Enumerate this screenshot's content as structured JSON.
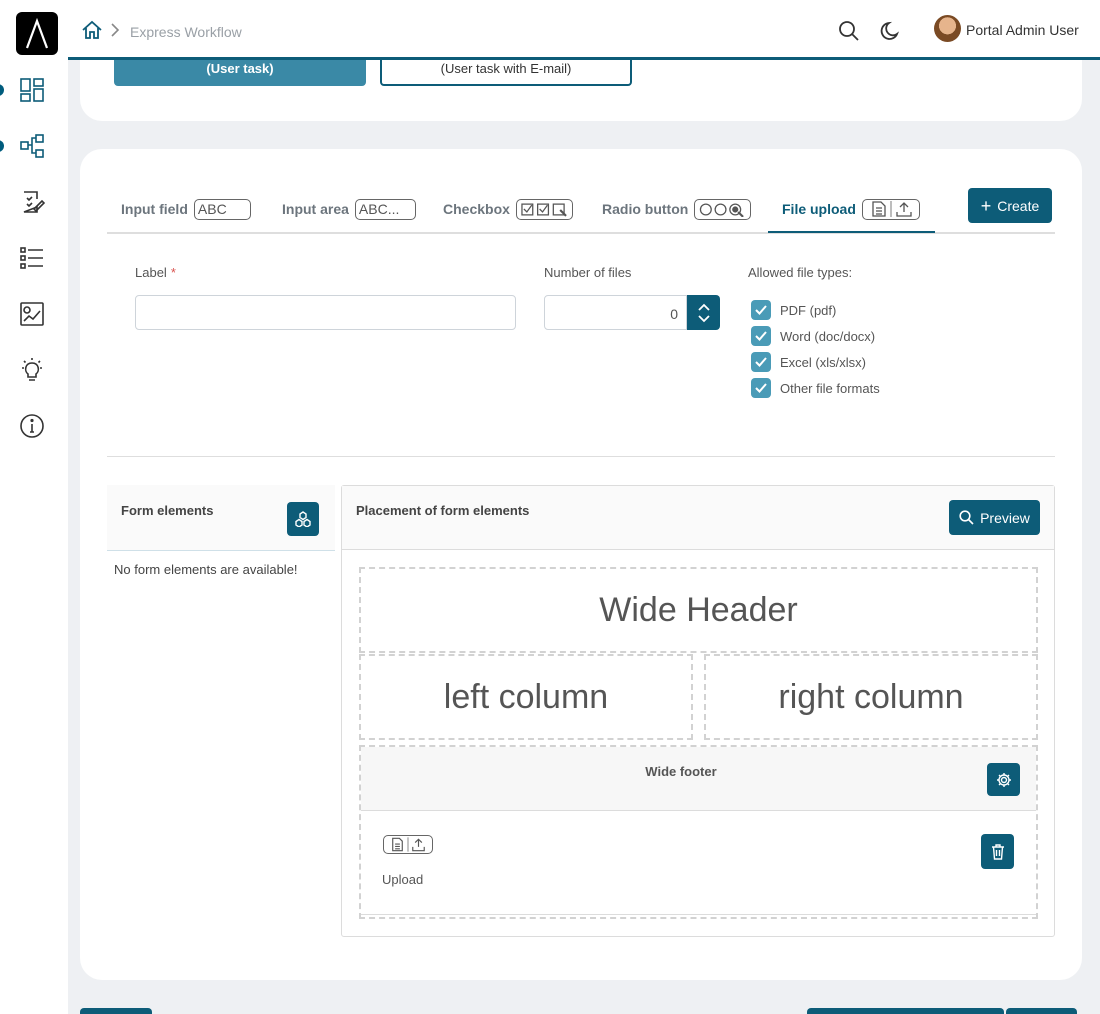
{
  "header": {
    "breadcrumb_current": "Express Workflow",
    "user_name": "Portal Admin User"
  },
  "top_card": {
    "user_task_label": "(User task)",
    "user_task_mail_label": "(User task with E-mail)"
  },
  "tabs": [
    {
      "label": "Input field",
      "icon_text": "ABC",
      "icon": "abc-text-icon"
    },
    {
      "label": "Input area",
      "icon_text": "ABC...",
      "icon": "text-area-icon"
    },
    {
      "label": "Checkbox",
      "icon_text": "",
      "icon": "checkbox-group-icon"
    },
    {
      "label": "Radio button",
      "icon_text": "",
      "icon": "radio-group-icon"
    },
    {
      "label": "File upload",
      "icon_text": "",
      "icon": "file-upload-icon",
      "active": true
    }
  ],
  "create_label": "Create",
  "form": {
    "label_title": "Label",
    "required_mark": "*",
    "label_value": "",
    "files_title": "Number of files",
    "files_value": "0",
    "allowed_title": "Allowed file types:",
    "file_types": [
      {
        "label": "PDF (pdf)",
        "checked": true
      },
      {
        "label": "Word (doc/docx)",
        "checked": true
      },
      {
        "label": "Excel (xls/xlsx)",
        "checked": true
      },
      {
        "label": "Other file formats",
        "checked": true
      }
    ]
  },
  "form_elements": {
    "title": "Form elements",
    "empty_text": "No form elements are available!"
  },
  "placement": {
    "title": "Placement of form elements",
    "preview_label": "Preview",
    "wide_header": "Wide Header",
    "left_column": "left column",
    "right_column": "right column",
    "wide_footer": "Wide footer",
    "upload_label": "Upload"
  },
  "colors": {
    "primary": "#0d5c78",
    "checkbox": "#4a9bb7"
  }
}
